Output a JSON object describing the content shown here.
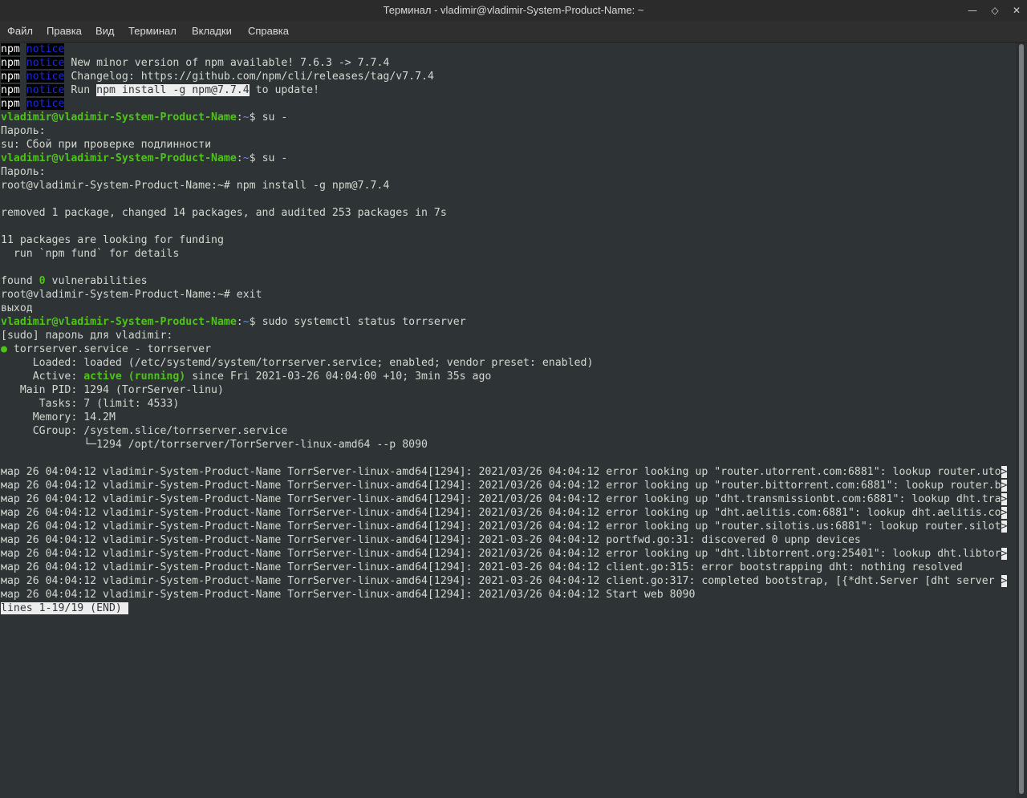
{
  "window": {
    "title": "Терминал - vladimir@vladimir-System-Product-Name: ~",
    "controls": [
      "minimize-icon",
      "maximize-icon",
      "close-icon"
    ]
  },
  "menu": {
    "items": [
      "Файл",
      "Правка",
      "Вид",
      "Терминал",
      "Вкладки",
      "Справка"
    ]
  },
  "terminal": {
    "npm_label": "npm",
    "notice_label": "notice",
    "notice_lines": [
      "",
      " New minor version of npm available! 7.6.3 -> 7.7.4",
      " Changelog: https://github.com/npm/cli/releases/tag/v7.7.4",
      " Run ",
      ""
    ],
    "run_cmd": "npm install -g npm@7.7.4",
    "run_tail": " to update!",
    "prompt_user": "vladimir@vladimir-System-Product-Name",
    "prompt_path": "~",
    "prompt_sym": "$",
    "cmd_su": " su -",
    "password_prompt": "Пароль:",
    "su_fail": "su: Сбой при проверке подлинности",
    "root_prompt_1": "root@vladimir-System-Product-Name:~# npm install -g npm@7.7.4",
    "removed_line": "removed 1 package, changed 14 packages, and audited 253 packages in 7s",
    "funding_1": "11 packages are looking for funding",
    "funding_2": "  run `npm fund` for details",
    "found_pre": "found ",
    "found_num": "0",
    "found_post": " vulnerabilities",
    "root_prompt_2": "root@vladimir-System-Product-Name:~# exit",
    "exit_word": "выход",
    "cmd_status": " sudo systemctl status torrserver",
    "sudo_prompt": "[sudo] пароль для vladimir:",
    "service_dot": "●",
    "service_name": " torrserver.service - torrserver",
    "loaded": "     Loaded: loaded (/etc/systemd/system/torrserver.service; enabled; vendor preset: enabled)",
    "active_pre": "     Active: ",
    "active_state": "active (running)",
    "active_post": " since Fri 2021-03-26 04:04:00 +10; 3min 35s ago",
    "main_pid": "   Main PID: 1294 (TorrServer-linu)",
    "tasks": "      Tasks: 7 (limit: 4533)",
    "memory": "     Memory: 14.2M",
    "cgroup": "     CGroup: /system.slice/torrserver.service",
    "cgroup_child": "             └─1294 /opt/torrserver/TorrServer-linux-amd64 --p 8090",
    "log_lines": [
      "мар 26 04:04:12 vladimir-System-Product-Name TorrServer-linux-amd64[1294]: 2021/03/26 04:04:12 error looking up \"router.utorrent.com:6881\": lookup router.uto",
      "мар 26 04:04:12 vladimir-System-Product-Name TorrServer-linux-amd64[1294]: 2021/03/26 04:04:12 error looking up \"router.bittorrent.com:6881\": lookup router.b",
      "мар 26 04:04:12 vladimir-System-Product-Name TorrServer-linux-amd64[1294]: 2021/03/26 04:04:12 error looking up \"dht.transmissionbt.com:6881\": lookup dht.tra",
      "мар 26 04:04:12 vladimir-System-Product-Name TorrServer-linux-amd64[1294]: 2021/03/26 04:04:12 error looking up \"dht.aelitis.com:6881\": lookup dht.aelitis.co",
      "мар 26 04:04:12 vladimir-System-Product-Name TorrServer-linux-amd64[1294]: 2021/03/26 04:04:12 error looking up \"router.silotis.us:6881\": lookup router.silot",
      "мар 26 04:04:12 vladimir-System-Product-Name TorrServer-linux-amd64[1294]: 2021-03-26 04:04:12 portfwd.go:31: discovered 0 upnp devices",
      "мар 26 04:04:12 vladimir-System-Product-Name TorrServer-linux-amd64[1294]: 2021/03/26 04:04:12 error looking up \"dht.libtorrent.org:25401\": lookup dht.libtor",
      "мар 26 04:04:12 vladimir-System-Product-Name TorrServer-linux-amd64[1294]: 2021-03-26 04:04:12 client.go:315: error bootstrapping dht: nothing resolved",
      "мар 26 04:04:12 vladimir-System-Product-Name TorrServer-linux-amd64[1294]: 2021-03-26 04:04:12 client.go:317: completed bootstrap, [{*dht.Server [dht server ",
      "мар 26 04:04:12 vladimir-System-Product-Name TorrServer-linux-amd64[1294]: 2021/03/26 04:04:12 Start web 8090"
    ],
    "truncated_marker": ">",
    "pager_status": "lines 1-19/19 (END) "
  },
  "colors": {
    "background": "#2e3436",
    "prompt_green": "#4ec416",
    "path_blue": "#6b86e0",
    "notice_blue": "#1d2bd0"
  }
}
